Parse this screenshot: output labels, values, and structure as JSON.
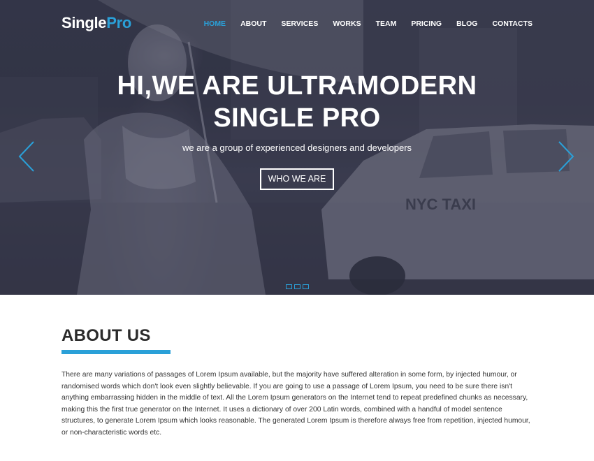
{
  "brand": {
    "logo_part_a": "Single",
    "logo_part_b": "Pro",
    "accent_color": "#2aa0d8"
  },
  "nav": {
    "items": [
      {
        "label": "HOME",
        "active": true
      },
      {
        "label": "ABOUT",
        "active": false
      },
      {
        "label": "SERVICES",
        "active": false
      },
      {
        "label": "WORKS",
        "active": false
      },
      {
        "label": "TEAM",
        "active": false
      },
      {
        "label": "PRICING",
        "active": false
      },
      {
        "label": "BLOG",
        "active": false
      },
      {
        "label": "CONTACTS",
        "active": false
      }
    ]
  },
  "hero": {
    "title_line1": "HI,WE ARE ULTRAMODERN",
    "title_line2": "SINGLE PRO",
    "subtitle": "we are a group of experienced designers and developers",
    "button_label": "WHO WE ARE",
    "prev_icon": "chevron-left-icon",
    "next_icon": "chevron-right-icon",
    "slide_count": 3
  },
  "about": {
    "title": "ABOUT US",
    "text": "There are many variations of passages of Lorem Ipsum available, but the majority have suffered alteration in some form, by injected humour, or randomised words which don't look even slightly believable. If you are going to use a passage of Lorem Ipsum, you need to be sure there isn't anything embarrassing hidden in the middle of text. All the Lorem Ipsum generators on the Internet tend to repeat predefined chunks as necessary, making this the first true generator on the Internet. It uses a dictionary of over 200 Latin words, combined with a handful of model sentence structures, to generate Lorem Ipsum which looks reasonable. The generated Lorem Ipsum is therefore always free from repetition, injected humour, or non-characteristic words etc."
  }
}
